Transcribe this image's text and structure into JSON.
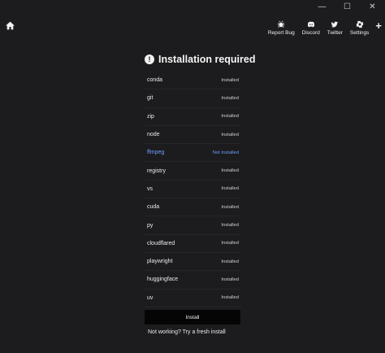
{
  "window_controls": {
    "minimize": "—",
    "maximize": "☐",
    "close": "✕"
  },
  "nav": {
    "home_icon": "home-icon",
    "items": [
      {
        "label": "Report Bug",
        "icon": "bug-icon"
      },
      {
        "label": "Discord",
        "icon": "discord-icon"
      },
      {
        "label": "Twitter",
        "icon": "twitter-icon"
      },
      {
        "label": "Settings",
        "icon": "gear-icon"
      }
    ],
    "add_label": "+"
  },
  "main": {
    "title": "Installation required",
    "title_icon": "!",
    "dependencies": [
      {
        "name": "conda",
        "status": "Installed"
      },
      {
        "name": "git",
        "status": "Installed"
      },
      {
        "name": "zip",
        "status": "Installed"
      },
      {
        "name": "node",
        "status": "Installed"
      },
      {
        "name": "ffmpeg",
        "status": "Not Installed"
      },
      {
        "name": "registry",
        "status": "Installed"
      },
      {
        "name": "vs",
        "status": "Installed"
      },
      {
        "name": "cuda",
        "status": "Installed"
      },
      {
        "name": "py",
        "status": "Installed"
      },
      {
        "name": "cloudflared",
        "status": "Installed"
      },
      {
        "name": "playwright",
        "status": "Installed"
      },
      {
        "name": "huggingface",
        "status": "Installed"
      },
      {
        "name": "uv",
        "status": "Installed"
      }
    ],
    "install_label": "Install",
    "fresh_install_label": "Not working? Try a fresh install"
  },
  "colors": {
    "background": "#1c1c1e",
    "accent_missing": "#6f9dff",
    "button_bg": "#050505"
  }
}
